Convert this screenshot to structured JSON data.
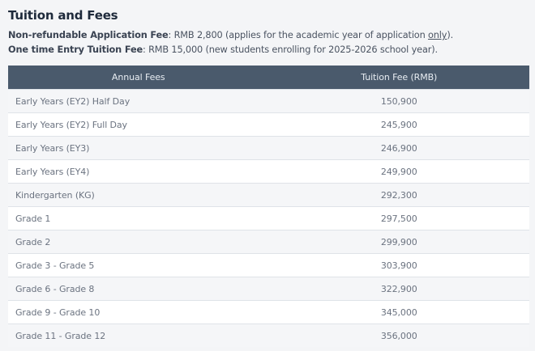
{
  "section": {
    "title": "Tuition and Fees"
  },
  "notes": [
    {
      "label": "Non-refundable Application Fee",
      "text_before": ": RMB 2,800 (applies for the academic year of application ",
      "emphasis": "only",
      "text_after": ")."
    },
    {
      "label": "One time Entry Tuition Fee",
      "text": ": RMB 15,000 (new students enrolling for 2025-2026 school year)."
    }
  ],
  "fees_table": {
    "headers": [
      "Annual Fees",
      "Tuition Fee (RMB)"
    ],
    "rows": [
      {
        "name": "Early Years (EY2) Half Day",
        "fee": "150,900"
      },
      {
        "name": "Early Years (EY2) Full Day",
        "fee": "245,900"
      },
      {
        "name": "Early Years (EY3)",
        "fee": "246,900"
      },
      {
        "name": "Early Years (EY4)",
        "fee": "249,900"
      },
      {
        "name": "Kindergarten (KG)",
        "fee": "292,300"
      },
      {
        "name": "Grade 1",
        "fee": "297,500"
      },
      {
        "name": "Grade 2",
        "fee": "299,900"
      },
      {
        "name": "Grade 3 - Grade 5",
        "fee": "303,900"
      },
      {
        "name": "Grade 6 - Grade 8",
        "fee": "322,900"
      },
      {
        "name": "Grade 9 - Grade 10",
        "fee": "345,000"
      },
      {
        "name": "Grade 11 - Grade 12",
        "fee": "356,000"
      }
    ]
  },
  "colors": {
    "header_bg": "#4a5a6c",
    "title": "#1e2a3b",
    "page_bg": "#f4f5f7"
  }
}
